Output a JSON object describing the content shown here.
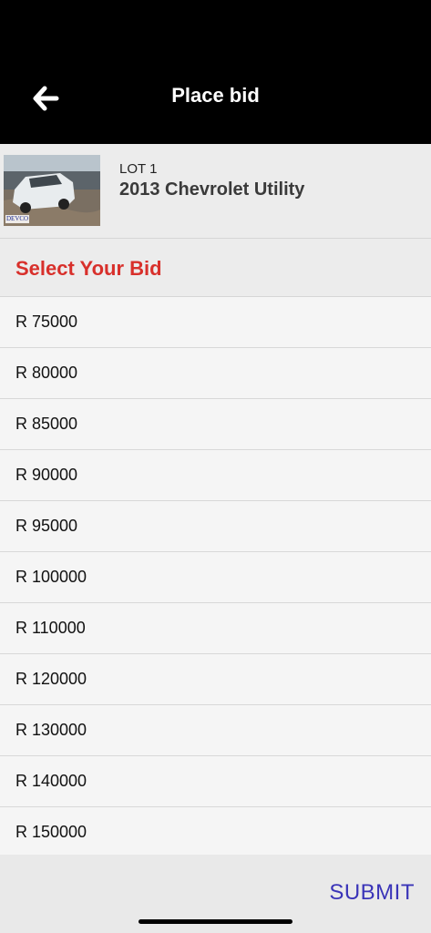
{
  "header": {
    "title": "Place bid",
    "back_icon": "arrow-left-icon"
  },
  "lot": {
    "number": "LOT 1",
    "title": "2013 Chevrolet Utility",
    "thumbnail_watermark": "DEVCO"
  },
  "section": {
    "title": "Select Your Bid"
  },
  "bids": [
    "R 75000",
    "R 80000",
    "R 85000",
    "R 90000",
    "R 95000",
    "R 100000",
    "R 110000",
    "R 120000",
    "R 130000",
    "R 140000",
    "R 150000"
  ],
  "footer": {
    "submit_label": "SUBMIT"
  },
  "colors": {
    "header_bg": "#000000",
    "accent_red": "#d8302b",
    "submit_blue": "#3a34b8"
  }
}
